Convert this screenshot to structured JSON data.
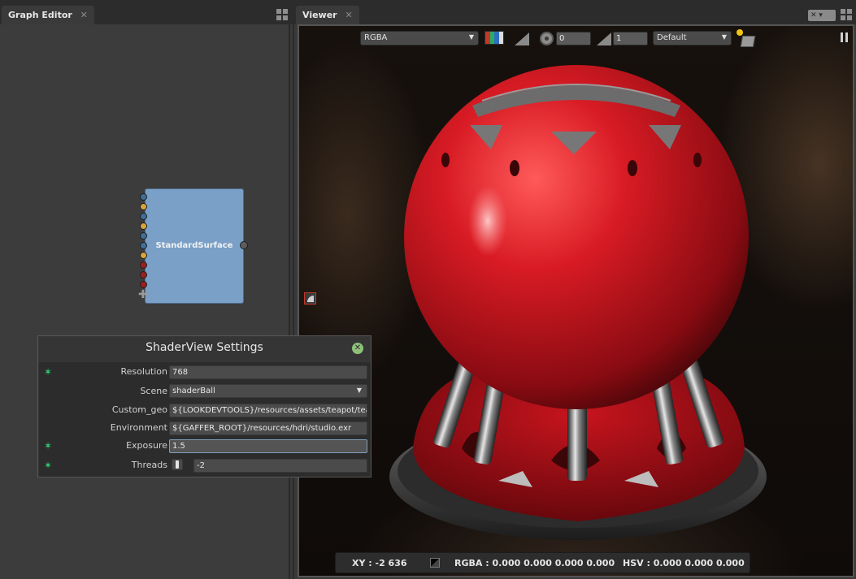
{
  "graph_editor": {
    "tab_label": "Graph Editor",
    "node": {
      "label": "StandardSurface"
    }
  },
  "viewer": {
    "tab_label": "Viewer",
    "toolbar": {
      "channel_mode": "RGBA",
      "exposure_value": "0",
      "gamma_value": "1",
      "display_transform": "Default"
    },
    "status": {
      "xy": "XY : -2 636",
      "rgba": "RGBA : 0.000 0.000 0.000 0.000",
      "hsv": "HSV : 0.000 0.000 0.000"
    }
  },
  "shaderview_settings": {
    "title": "ShaderView Settings",
    "rows": [
      {
        "label": "Resolution",
        "value": "768"
      },
      {
        "label": "Scene",
        "value": "shaderBall"
      },
      {
        "label": "Custom_geo",
        "value": "${LOOKDEVTOOLS}/resources/assets/teapot/teapot.abc"
      },
      {
        "label": "Environment",
        "value": "${GAFFER_ROOT}/resources/hdri/studio.exr"
      },
      {
        "label": "Exposure",
        "value": "1.5"
      },
      {
        "label": "Threads",
        "value": "-2"
      }
    ]
  },
  "colors": {
    "node_fill": "#7aa0c8",
    "shader_ball_red": "#c8141e",
    "plug_blue": "#3e6f9a",
    "plug_yellow": "#d9a53a",
    "plug_red": "#9c1f1f",
    "active_star": "#2ecc71"
  }
}
